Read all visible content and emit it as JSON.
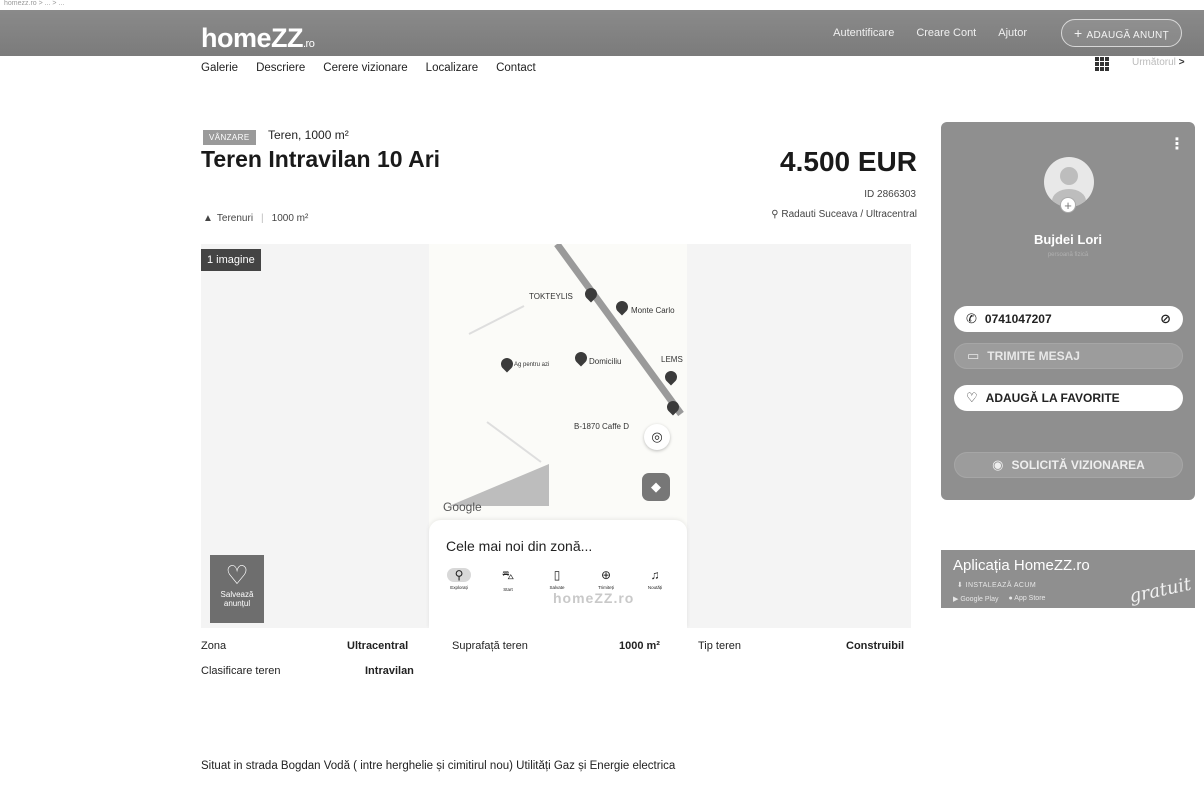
{
  "breadcrumb": "homezz.ro > ... > ...",
  "header": {
    "logo": "homeZZ",
    "logo_tld": ".ro",
    "links": [
      "Autentificare",
      "Creare Cont",
      "Ajutor"
    ],
    "add_button": "ADAUGĂ ANUNȚ"
  },
  "subnav": {
    "items": [
      "Galerie",
      "Descriere",
      "Cerere vizionare",
      "Localizare",
      "Contact"
    ],
    "next_label": "Următorul"
  },
  "listing": {
    "badge": "VÂNZARE",
    "type": "Teren, 1000 m²",
    "title": "Teren Intravilan 10 Ari",
    "price": "4.500 EUR",
    "id": "ID 2866303",
    "location": "Radauti Suceava / Ultracentral",
    "feature_type": "Terenuri",
    "feature_area": "1000 m²"
  },
  "gallery": {
    "image_count": "1 imagine",
    "save_label": "Salvează anunțul",
    "watermark": "homeZZ.ro",
    "map": {
      "labels": [
        "TOKTEYLIS",
        "Monte Carlo",
        "Domiciliu",
        "LEMS",
        "B-1870 Caffe D",
        "Ag pentru azi",
        "Google"
      ],
      "sheet_title": "Cele mai noi din zonă...",
      "nav": [
        "Explorați",
        "Start",
        "Salvate",
        "Trimiteți",
        "Noutăți"
      ]
    }
  },
  "agent": {
    "name": "Bujdei Lori",
    "subtitle": "persoană fizică",
    "phone": "0741047207",
    "message_btn": "TRIMITE MESAJ",
    "favorite_btn": "ADAUGĂ LA FAVORITE",
    "visit_btn": "SOLICITĂ VIZIONAREA"
  },
  "app_banner": {
    "title": "Aplicația HomeZZ.ro",
    "install": "INSTALEAZĂ ACUM",
    "free": "gratuit",
    "google_play": "Google Play",
    "app_store": "App Store"
  },
  "details": {
    "rows": [
      {
        "label": "Zona",
        "value": "Ultracentral"
      },
      {
        "label": "Suprafață teren",
        "value": "1000 m²"
      },
      {
        "label": "Tip teren",
        "value": "Construibil"
      },
      {
        "label": "Clasificare teren",
        "value": "Intravilan"
      }
    ]
  },
  "description": "Situat in strada Bogdan Vodă ( intre herghelie și cimitirul nou) Utilități Gaz și Energie electrica"
}
